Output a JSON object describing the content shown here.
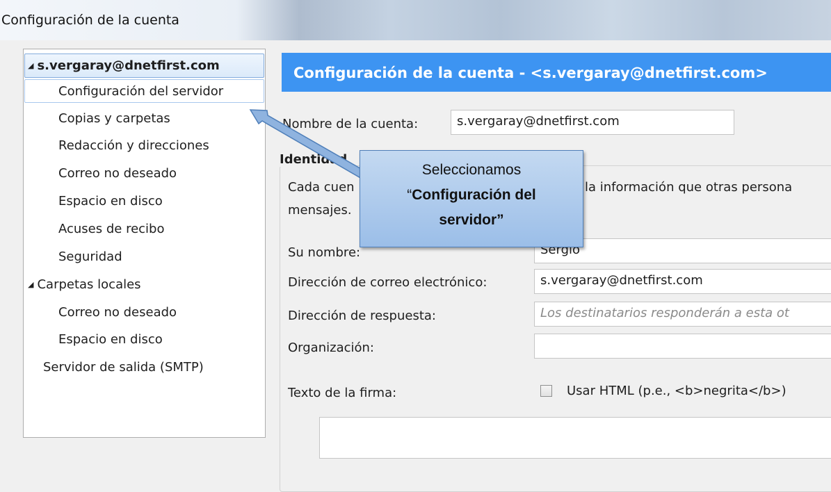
{
  "window": {
    "title": "Configuración de la cuenta"
  },
  "tree": {
    "root_account": "s.vergaray@dnetfirst.com",
    "account_items": [
      "Configuración del servidor",
      "Copias y carpetas",
      "Redacción y direcciones",
      "Correo no deseado",
      "Espacio en disco",
      "Acuses de recibo",
      "Seguridad"
    ],
    "local_folders": "Carpetas locales",
    "local_items": [
      "Correo no deseado",
      "Espacio en disco"
    ],
    "smtp": "Servidor de salida (SMTP)",
    "selected": "Configuración del servidor"
  },
  "panel": {
    "header": "Configuración de la cuenta - <s.vergaray@dnetfirst.com>",
    "account_name_label": "Nombre de la cuenta:",
    "account_name_value": "s.vergaray@dnetfirst.com",
    "identity_legend": "Identidad",
    "identity_desc_1": "Cada cuen",
    "identity_desc_1b": "la información que otras persona",
    "identity_desc_2": "mensajes.",
    "your_name_label": "Su nombre:",
    "your_name_value": "Sergio",
    "email_label": "Dirección de correo electrónico:",
    "email_value": "s.vergaray@dnetfirst.com",
    "reply_label": "Dirección de respuesta:",
    "reply_placeholder": "Los destinatarios responderán a esta ot",
    "org_label": "Organización:",
    "org_value": "",
    "signature_label": "Texto de la firma:",
    "use_html_label": "Usar HTML (p.e., <b>negrita</b>)",
    "use_html_checked": false
  },
  "callout": {
    "line1": "Seleccionamos",
    "line2": "Configuración del",
    "line3": "servidor”",
    "open_quote": "“"
  },
  "colors": {
    "header_bg": "#3d94f2",
    "callout_bg": "#b0cdee",
    "selection_border": "#84acdd"
  }
}
